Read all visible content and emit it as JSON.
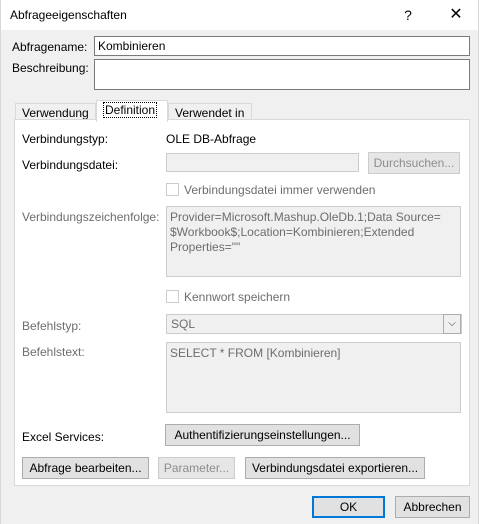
{
  "window": {
    "title": "Abfrageeigenschaften",
    "help_glyph": "?",
    "close_glyph": "✕"
  },
  "query": {
    "name_label": "Abfragename:",
    "name_value": "Kombinieren",
    "description_label": "Beschreibung:",
    "description_value": ""
  },
  "tabs": [
    {
      "label": "Verwendung",
      "active": false
    },
    {
      "label": "Definition",
      "active": true
    },
    {
      "label": "Verwendet in",
      "active": false
    }
  ],
  "definition": {
    "connection_type_label": "Verbindungstyp:",
    "connection_type_value": "OLE DB-Abfrage",
    "connection_file_label": "Verbindungsdatei:",
    "connection_file_value": "",
    "browse_button": "Durchsuchen...",
    "always_use_file_label": "Verbindungsdatei immer verwenden",
    "connection_string_label": "Verbindungszeichenfolge:",
    "connection_string_value": "Provider=Microsoft.Mashup.OleDb.1;Data Source=\n$Workbook$;Location=Kombinieren;Extended\nProperties=\"\"",
    "save_password_label": "Kennwort speichern",
    "command_type_label": "Befehlstyp:",
    "command_type_value": "SQL",
    "command_text_label": "Befehlstext:",
    "command_text_value": "SELECT * FROM [Kombinieren]",
    "excel_services_label": "Excel Services:",
    "auth_settings_button": "Authentifizierungseinstellungen...",
    "edit_query_button": "Abfrage bearbeiten...",
    "parameters_button": "Parameter...",
    "export_connection_button": "Verbindungsdatei exportieren..."
  },
  "footer": {
    "ok_button": "OK",
    "cancel_button": "Abbrechen"
  }
}
